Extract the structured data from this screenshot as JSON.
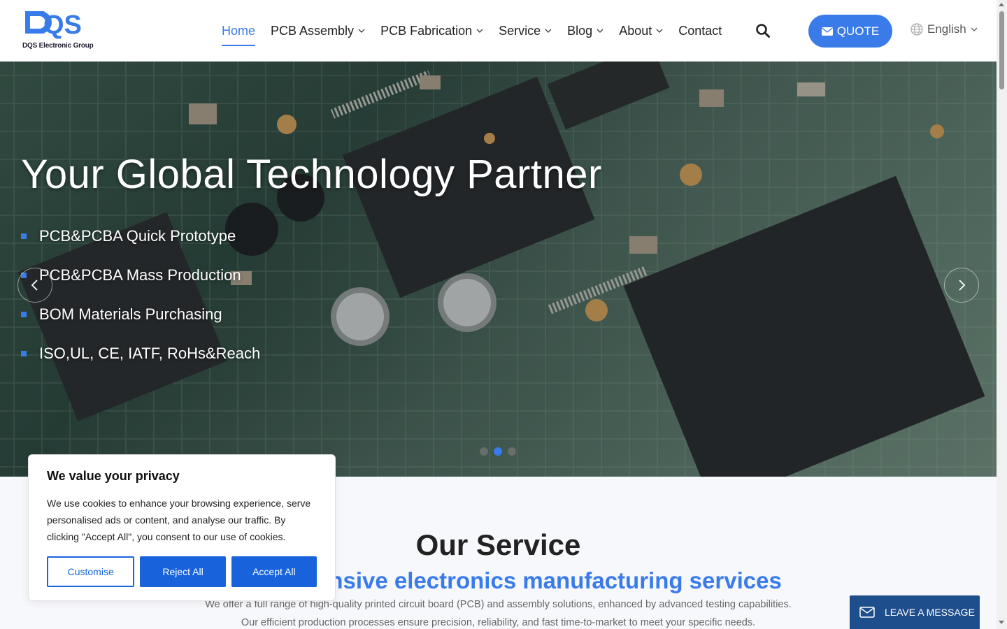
{
  "brand": {
    "logo_letters": "QS",
    "logo_caption": "DQS Electronic Group",
    "primary_color": "#3a7bea",
    "dark_blue": "#1f4e8c",
    "cookie_blue": "#1863dc"
  },
  "nav": {
    "items": [
      {
        "label": "Home",
        "active": true,
        "has_dropdown": false
      },
      {
        "label": "PCB Assembly",
        "active": false,
        "has_dropdown": true
      },
      {
        "label": "PCB Fabrication",
        "active": false,
        "has_dropdown": true
      },
      {
        "label": "Service",
        "active": false,
        "has_dropdown": true
      },
      {
        "label": "Blog",
        "active": false,
        "has_dropdown": true
      },
      {
        "label": "About",
        "active": false,
        "has_dropdown": true
      },
      {
        "label": "Contact",
        "active": false,
        "has_dropdown": false
      }
    ],
    "search_icon": "search-icon",
    "quote_label": "QUOTE",
    "quote_icon": "envelope-icon",
    "language": "English",
    "language_icon": "globe-icon"
  },
  "hero": {
    "title": "Your Global Technology Partner",
    "bullets": [
      "PCB&PCBA Quick Prototype",
      "PCB&PCBA Mass Production",
      "BOM Materials Purchasing",
      "ISO,UL, CE, IATF, RoHs&Reach"
    ],
    "slide_count": 3,
    "active_slide": 2
  },
  "services": {
    "title": "Our Service",
    "subtitle": "Comprehensive electronics manufacturing services",
    "description": "We offer a full range of high-quality printed circuit board (PCB) and assembly solutions, enhanced by advanced testing capabilities. Our efficient production processes ensure precision, reliability, and fast time-to-market to meet your specific needs."
  },
  "cookie": {
    "title": "We value your privacy",
    "text": "We use cookies to enhance your browsing experience, serve personalised ads or content, and analyse our traffic. By clicking \"Accept All\", you consent to our use of cookies.",
    "customise_label": "Customise",
    "reject_label": "Reject All",
    "accept_label": "Accept All"
  },
  "leave_message": {
    "label": "LEAVE A MESSAGE",
    "icon": "envelope-icon"
  }
}
